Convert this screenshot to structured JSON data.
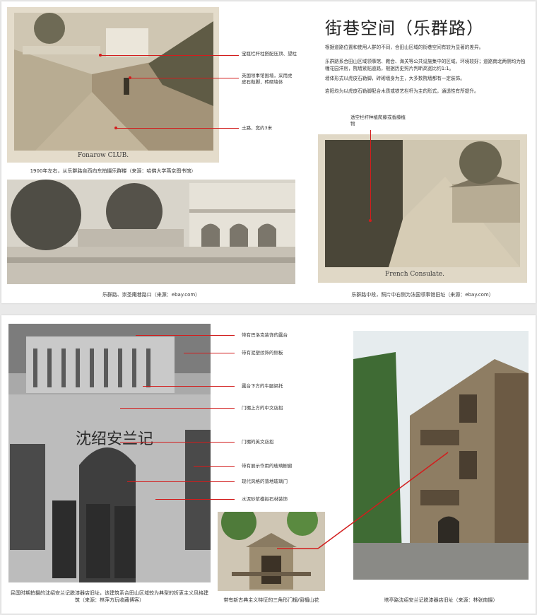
{
  "top": {
    "title": "街巷空间（乐群路）",
    "paragraphs": [
      "根据道路位置和使用人群的不同，合田山区域的街巷空间有较为显著的差异。",
      "乐群路系合田山区域领事馆、教会、海关等公共设施集中的区域，环境较好；道路南北两侧均为独幢花园洋房，院墙紧贴道路，根据历史照片判断高宽比约1:1。",
      "墙体形式以虎皮石勒脚，砖砌墙身为主，大多数院墙都有一定装饰。",
      "岩阳均为以虎皮石勒脚配合木质或铁艺栏杆为主的形式，通透性有所提升。"
    ],
    "photo1": {
      "inscription": "Fonarow CLUB.",
      "labels": [
        "宝瓶栏杆柱搭配压顶、望柱",
        "英国领事馆围墙，采用虎皮石勒脚，砖砌墙体",
        "土路，宽约3米"
      ],
      "caption": "1900年左右，从乐群路自西向东拍摄乐群楼（来源：哈佛大学燕京图书馆）"
    },
    "photo2": {
      "caption": "乐群路、崇圣庵巷路口（来源：ebay.com）"
    },
    "photo3": {
      "inscription": "French Consulate.",
      "label": "透空栏杆种植爬藤或香藤植物",
      "caption": "乐群路中段，照片中右侧为法国领事馆旧址（来源：ebay.com）"
    }
  },
  "bottom": {
    "sign": "沈绍安兰记",
    "labels": [
      "带有巴洛克装饰的露台",
      "带有泥塑纹饰的侧板",
      "露台下方的牛腿梁托",
      "门楣上方的中文店招",
      "门楣的英文店招",
      "带有展示作用的玻璃橱窗",
      "现代风格的落地玻璃门",
      "水泥砂浆模拟石材装饰"
    ],
    "captions": {
      "left": "民国时期拍摄的沈绍安兰记脱漆器店旧址，该建筑系合田山区域较为典型的折衷主义风格建筑（来源：林萍方玩收藏博客）",
      "middle": "带有新古典主义特征的三角形门楣/窗楣山花",
      "right": "塔亭路沈绍安兰记脱漆器店旧址（来源：林张南摄）"
    }
  },
  "colors": {
    "accent": "#d21d1d",
    "panel": "#ffffff",
    "background": "#e9e9e9"
  }
}
